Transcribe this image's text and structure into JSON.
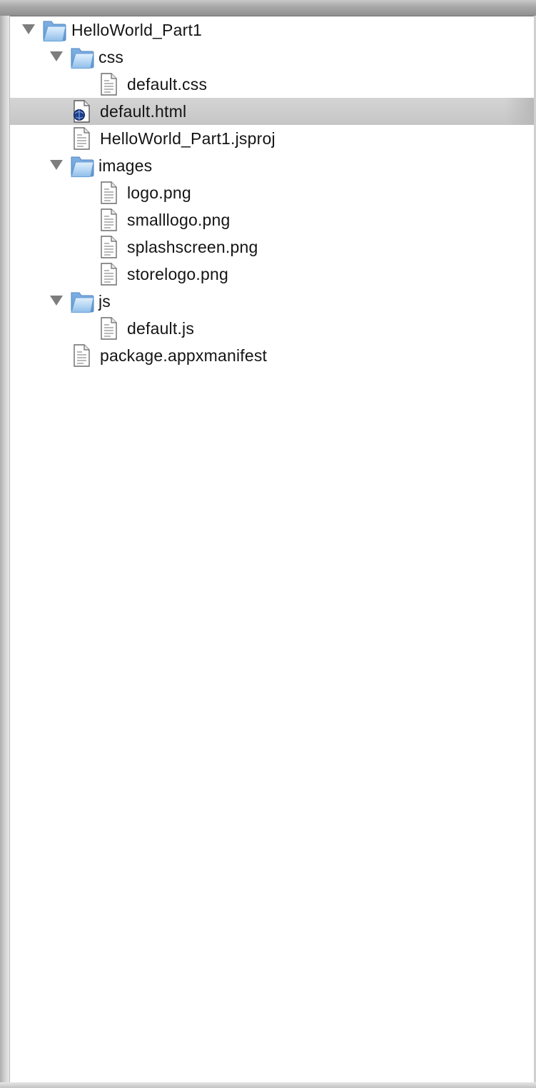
{
  "colors": {
    "folder": "#9cc7f0",
    "selection": "#c9c9c9",
    "disclosure": "#7d7d7d"
  },
  "tree": {
    "root": {
      "label": "HelloWorld_Part1",
      "icon": "folder-icon",
      "expanded": true
    },
    "css_folder": {
      "label": "css",
      "icon": "folder-icon",
      "expanded": true
    },
    "default_css": {
      "label": "default.css",
      "icon": "document-icon"
    },
    "default_html": {
      "label": "default.html",
      "icon": "html-document-icon",
      "selected": true
    },
    "jsproj": {
      "label": "HelloWorld_Part1.jsproj",
      "icon": "document-icon"
    },
    "images_folder": {
      "label": "images",
      "icon": "folder-icon",
      "expanded": true
    },
    "logo_png": {
      "label": "logo.png",
      "icon": "document-icon"
    },
    "smalllogo_png": {
      "label": "smalllogo.png",
      "icon": "document-icon"
    },
    "splashscreen_png": {
      "label": "splashscreen.png",
      "icon": "document-icon"
    },
    "storelogo_png": {
      "label": "storelogo.png",
      "icon": "document-icon"
    },
    "js_folder": {
      "label": "js",
      "icon": "folder-icon",
      "expanded": true
    },
    "default_js": {
      "label": "default.js",
      "icon": "document-icon"
    },
    "manifest": {
      "label": "package.appxmanifest",
      "icon": "document-icon"
    }
  }
}
